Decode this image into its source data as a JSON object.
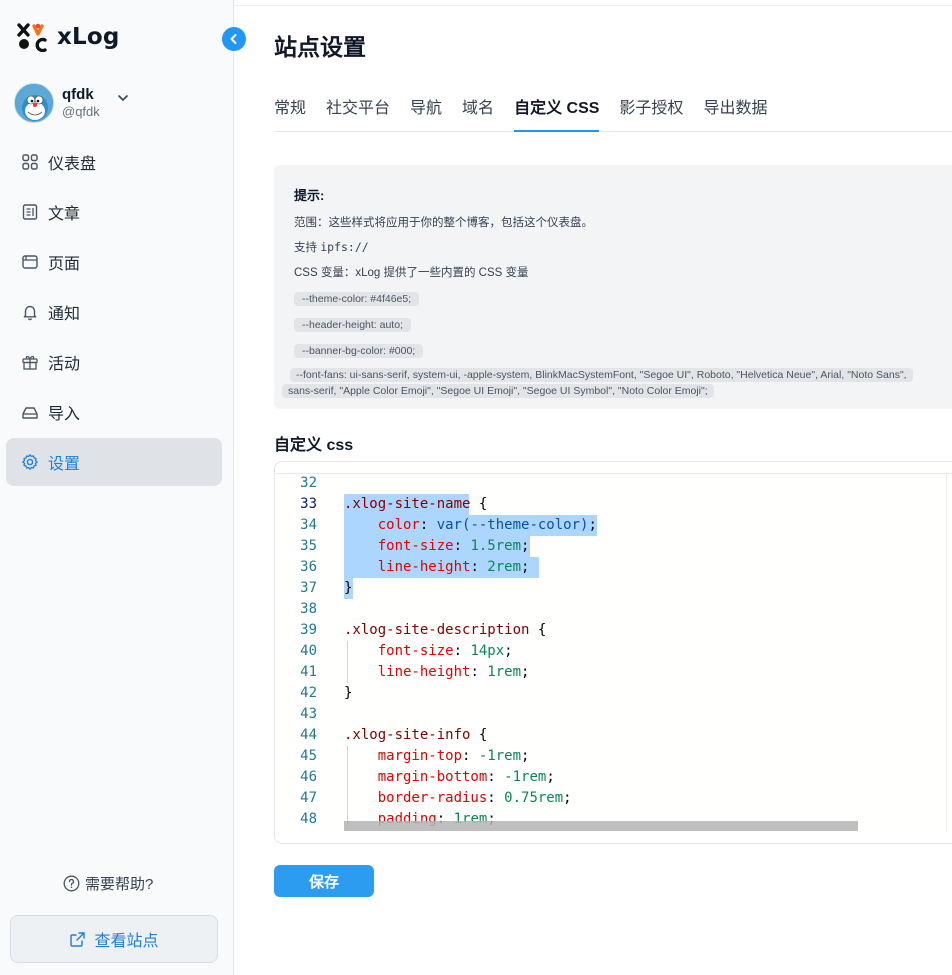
{
  "app": {
    "name": "xLog"
  },
  "user": {
    "display_name": "qfdk",
    "handle": "@qfdk"
  },
  "sidebar": {
    "items": [
      {
        "label": "仪表盘",
        "icon": "dashboard-icon"
      },
      {
        "label": "文章",
        "icon": "article-icon"
      },
      {
        "label": "页面",
        "icon": "page-icon"
      },
      {
        "label": "通知",
        "icon": "bell-icon"
      },
      {
        "label": "活动",
        "icon": "gift-icon"
      },
      {
        "label": "导入",
        "icon": "import-icon"
      },
      {
        "label": "设置",
        "icon": "gear-icon",
        "active": true
      }
    ],
    "help_label": "需要帮助?",
    "view_site_label": "查看站点"
  },
  "page": {
    "title": "站点设置",
    "tabs": [
      {
        "label": "常规"
      },
      {
        "label": "社交平台"
      },
      {
        "label": "导航"
      },
      {
        "label": "域名"
      },
      {
        "label": "自定义 CSS",
        "active": true
      },
      {
        "label": "影子授权"
      },
      {
        "label": "导出数据"
      }
    ]
  },
  "tips": {
    "title": "提示:",
    "scope": "范围：这些样式将应用于你的整个博客，包括这个仪表盘。",
    "support_prefix": "支持 ",
    "support_code": "ipfs://",
    "vars_intro": "CSS 变量：xLog 提供了一些内置的 CSS 变量",
    "vars": [
      "--theme-color: #4f46e5;",
      "--header-height: auto;",
      "--banner-bg-color: #000;"
    ],
    "font_var_line1": "--font-fans: ui-sans-serif, system-ui, -apple-system, BlinkMacSystemFont, \"Segoe UI\", Roboto, \"Helvetica Neue\", Arial, \"Noto Sans\",",
    "font_var_line2": "sans-serif, \"Apple Color Emoji\", \"Segoe UI Emoji\", \"Segoe UI Symbol\", \"Noto Color Emoji\";"
  },
  "editor": {
    "label": "自定义 css",
    "current_line": 33,
    "lines": [
      {
        "n": "32",
        "indent": "",
        "parts": []
      },
      {
        "n": "33",
        "indent": "",
        "parts": [
          {
            "t": ".xlog-site-name",
            "c": "k"
          },
          {
            "t": " {",
            "c": ""
          }
        ]
      },
      {
        "n": "34",
        "indent": "    ",
        "parts": [
          {
            "t": "color",
            "c": "p"
          },
          {
            "t": ": ",
            "c": ""
          },
          {
            "t": "var(--theme-color)",
            "c": "f"
          },
          {
            "t": ";",
            "c": ""
          }
        ]
      },
      {
        "n": "35",
        "indent": "    ",
        "parts": [
          {
            "t": "font-size",
            "c": "p"
          },
          {
            "t": ": ",
            "c": ""
          },
          {
            "t": "1.5rem",
            "c": "v"
          },
          {
            "t": ";",
            "c": ""
          }
        ]
      },
      {
        "n": "36",
        "indent": "    ",
        "parts": [
          {
            "t": "line-height",
            "c": "p"
          },
          {
            "t": ": ",
            "c": ""
          },
          {
            "t": "2rem",
            "c": "v"
          },
          {
            "t": ";",
            "c": ""
          }
        ]
      },
      {
        "n": "37",
        "indent": "",
        "parts": [
          {
            "t": "}",
            "c": ""
          }
        ]
      },
      {
        "n": "38",
        "indent": "",
        "parts": []
      },
      {
        "n": "39",
        "indent": "",
        "parts": [
          {
            "t": ".xlog-site-description",
            "c": "k"
          },
          {
            "t": " {",
            "c": ""
          }
        ]
      },
      {
        "n": "40",
        "indent": "    ",
        "parts": [
          {
            "t": "font-size",
            "c": "p"
          },
          {
            "t": ": ",
            "c": ""
          },
          {
            "t": "14px",
            "c": "v"
          },
          {
            "t": ";",
            "c": ""
          }
        ]
      },
      {
        "n": "41",
        "indent": "    ",
        "parts": [
          {
            "t": "line-height",
            "c": "p"
          },
          {
            "t": ": ",
            "c": ""
          },
          {
            "t": "1rem",
            "c": "v"
          },
          {
            "t": ";",
            "c": ""
          }
        ]
      },
      {
        "n": "42",
        "indent": "",
        "parts": [
          {
            "t": "}",
            "c": ""
          }
        ]
      },
      {
        "n": "43",
        "indent": "",
        "parts": []
      },
      {
        "n": "44",
        "indent": "",
        "parts": [
          {
            "t": ".xlog-site-info",
            "c": "k"
          },
          {
            "t": " {",
            "c": ""
          }
        ]
      },
      {
        "n": "45",
        "indent": "    ",
        "parts": [
          {
            "t": "margin-top",
            "c": "p"
          },
          {
            "t": ": ",
            "c": ""
          },
          {
            "t": "-1rem",
            "c": "v"
          },
          {
            "t": ";",
            "c": ""
          }
        ]
      },
      {
        "n": "46",
        "indent": "    ",
        "parts": [
          {
            "t": "margin-bottom",
            "c": "p"
          },
          {
            "t": ": ",
            "c": ""
          },
          {
            "t": "-1rem",
            "c": "v"
          },
          {
            "t": ";",
            "c": ""
          }
        ]
      },
      {
        "n": "47",
        "indent": "    ",
        "parts": [
          {
            "t": "border-radius",
            "c": "p"
          },
          {
            "t": ": ",
            "c": ""
          },
          {
            "t": "0.75rem",
            "c": "v"
          },
          {
            "t": ";",
            "c": ""
          }
        ]
      },
      {
        "n": "48",
        "indent": "    ",
        "parts": [
          {
            "t": "padding",
            "c": "p"
          },
          {
            "t": ": ",
            "c": ""
          },
          {
            "t": "1rem",
            "c": "v"
          },
          {
            "t": ";",
            "c": ""
          }
        ]
      }
    ]
  },
  "actions": {
    "save_label": "保存"
  },
  "colors": {
    "accent": "#2196f3",
    "selection": "#add6ff",
    "active_nav_bg": "#dfe3e8"
  }
}
